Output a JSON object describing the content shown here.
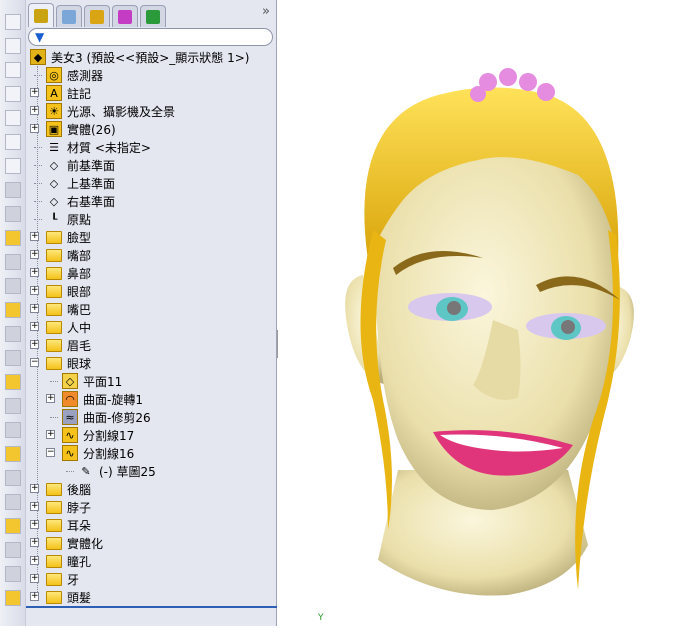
{
  "panel_tabs": [
    {
      "name": "featuremanager-tab",
      "icon": "feature-tree-icon"
    },
    {
      "name": "propertymanager-tab",
      "icon": "property-icon"
    },
    {
      "name": "configurationmanager-tab",
      "icon": "config-icon"
    },
    {
      "name": "dimxpert-tab",
      "icon": "crosshair-icon"
    },
    {
      "name": "display-manager-tab",
      "icon": "appearance-icon"
    }
  ],
  "more_label": "»",
  "filter_icon": "funnel-icon",
  "tree": {
    "root": "美女3  (預設<<預設>_顯示狀態 1>)",
    "items": [
      {
        "label": "感測器",
        "icon": "sensor-icon",
        "expand": ""
      },
      {
        "label": "註記",
        "icon": "annotation-icon",
        "expand": "+"
      },
      {
        "label": "光源、攝影機及全景",
        "icon": "lights-icon",
        "expand": "+"
      },
      {
        "label": "實體(26)",
        "icon": "solid-bodies-icon",
        "expand": "+"
      },
      {
        "label": "材質 <未指定>",
        "icon": "material-icon",
        "expand": ""
      },
      {
        "label": "前基準面",
        "icon": "plane-icon",
        "expand": ""
      },
      {
        "label": "上基準面",
        "icon": "plane-icon",
        "expand": ""
      },
      {
        "label": "右基準面",
        "icon": "plane-icon",
        "expand": ""
      },
      {
        "label": "原點",
        "icon": "origin-icon",
        "expand": ""
      },
      {
        "label": "臉型",
        "icon": "folder-icon",
        "expand": "+"
      },
      {
        "label": "嘴部",
        "icon": "folder-icon",
        "expand": "+"
      },
      {
        "label": "鼻部",
        "icon": "folder-icon",
        "expand": "+"
      },
      {
        "label": "眼部",
        "icon": "folder-icon",
        "expand": "+"
      },
      {
        "label": "嘴巴",
        "icon": "folder-icon",
        "expand": "+"
      },
      {
        "label": "人中",
        "icon": "folder-icon",
        "expand": "+"
      },
      {
        "label": "眉毛",
        "icon": "folder-icon",
        "expand": "+"
      },
      {
        "label": "眼球",
        "icon": "folder-icon",
        "expand": "−"
      },
      {
        "label": "平面11",
        "icon": "plane-feature-icon",
        "expand": "",
        "level": 2
      },
      {
        "label": "曲面-旋轉1",
        "icon": "surface-revolve-icon",
        "expand": "+",
        "level": 2
      },
      {
        "label": "曲面-修剪26",
        "icon": "surface-trim-icon",
        "expand": "",
        "level": 2
      },
      {
        "label": "分割線17",
        "icon": "split-line-icon",
        "expand": "+",
        "level": 2
      },
      {
        "label": "分割線16",
        "icon": "split-line-icon",
        "expand": "−",
        "level": 2
      },
      {
        "label": "(-) 草圖25",
        "icon": "sketch-icon",
        "expand": "",
        "level": 3
      },
      {
        "label": "後腦",
        "icon": "folder-icon",
        "expand": "+"
      },
      {
        "label": "脖子",
        "icon": "folder-icon",
        "expand": "+"
      },
      {
        "label": "耳朵",
        "icon": "folder-icon",
        "expand": "+"
      },
      {
        "label": "實體化",
        "icon": "folder-icon",
        "expand": "+"
      },
      {
        "label": "瞳孔",
        "icon": "folder-icon",
        "expand": "+"
      },
      {
        "label": "牙",
        "icon": "folder-icon",
        "expand": "+"
      },
      {
        "label": "頭髮",
        "icon": "folder-icon",
        "expand": "+"
      }
    ]
  },
  "axis_label": "Y",
  "colors": {
    "skin": "#f3eac0",
    "hair": "#f0c21c",
    "lips": "#e0357a",
    "eye_iris": "#5ec6c4",
    "eyeshadow": "#d9c8ee",
    "brow": "#8a6a1a",
    "beads": "#e58be0"
  }
}
